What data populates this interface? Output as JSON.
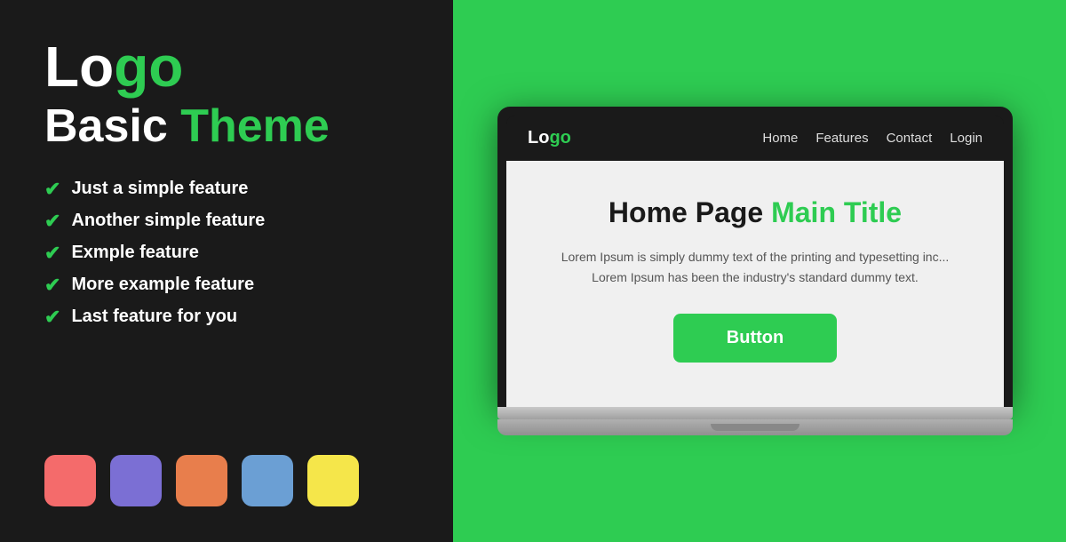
{
  "left": {
    "logo_text_black": "Lo",
    "logo_text_green": "go",
    "subtitle_black": "Basic ",
    "subtitle_green": "Theme",
    "features": [
      {
        "id": 1,
        "text": "Just a simple feature"
      },
      {
        "id": 2,
        "text": "Another simple feature"
      },
      {
        "id": 3,
        "text": "Exmple feature"
      },
      {
        "id": 4,
        "text": "More example feature"
      },
      {
        "id": 5,
        "text": "Last feature for you"
      }
    ],
    "swatches": [
      {
        "id": 1,
        "color": "#f46b6b",
        "name": "red-swatch"
      },
      {
        "id": 2,
        "color": "#7b6fd4",
        "name": "purple-swatch"
      },
      {
        "id": 3,
        "color": "#e87e4c",
        "name": "orange-swatch"
      },
      {
        "id": 4,
        "color": "#6b9fd4",
        "name": "blue-swatch"
      },
      {
        "id": 5,
        "color": "#f5e64a",
        "name": "yellow-swatch"
      }
    ]
  },
  "laptop": {
    "nav": {
      "logo_black": "Lo",
      "logo_green": "go",
      "links": [
        "Home",
        "Features",
        "Contact",
        "Login"
      ]
    },
    "hero": {
      "title_black": "Home Page ",
      "title_green": "Main Title",
      "body_text": "Lorem Ipsum is simply dummy text of the printing and typesetting inc... Lorem Ipsum has been the industry's standard dummy text.",
      "button_label": "Button"
    }
  },
  "colors": {
    "green": "#2ecc52",
    "dark": "#1a1a1a"
  }
}
